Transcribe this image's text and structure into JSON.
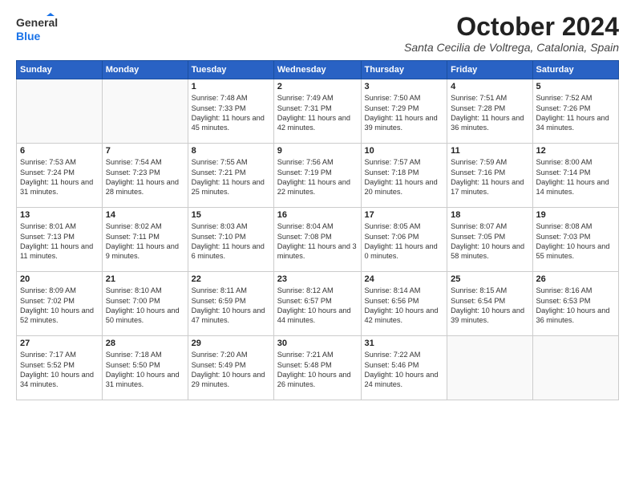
{
  "logo": {
    "line1": "General",
    "line2": "Blue"
  },
  "header": {
    "month": "October 2024",
    "location": "Santa Cecilia de Voltrega, Catalonia, Spain"
  },
  "weekdays": [
    "Sunday",
    "Monday",
    "Tuesday",
    "Wednesday",
    "Thursday",
    "Friday",
    "Saturday"
  ],
  "weeks": [
    [
      {
        "day": "",
        "info": ""
      },
      {
        "day": "",
        "info": ""
      },
      {
        "day": "1",
        "info": "Sunrise: 7:48 AM\nSunset: 7:33 PM\nDaylight: 11 hours and 45 minutes."
      },
      {
        "day": "2",
        "info": "Sunrise: 7:49 AM\nSunset: 7:31 PM\nDaylight: 11 hours and 42 minutes."
      },
      {
        "day": "3",
        "info": "Sunrise: 7:50 AM\nSunset: 7:29 PM\nDaylight: 11 hours and 39 minutes."
      },
      {
        "day": "4",
        "info": "Sunrise: 7:51 AM\nSunset: 7:28 PM\nDaylight: 11 hours and 36 minutes."
      },
      {
        "day": "5",
        "info": "Sunrise: 7:52 AM\nSunset: 7:26 PM\nDaylight: 11 hours and 34 minutes."
      }
    ],
    [
      {
        "day": "6",
        "info": "Sunrise: 7:53 AM\nSunset: 7:24 PM\nDaylight: 11 hours and 31 minutes."
      },
      {
        "day": "7",
        "info": "Sunrise: 7:54 AM\nSunset: 7:23 PM\nDaylight: 11 hours and 28 minutes."
      },
      {
        "day": "8",
        "info": "Sunrise: 7:55 AM\nSunset: 7:21 PM\nDaylight: 11 hours and 25 minutes."
      },
      {
        "day": "9",
        "info": "Sunrise: 7:56 AM\nSunset: 7:19 PM\nDaylight: 11 hours and 22 minutes."
      },
      {
        "day": "10",
        "info": "Sunrise: 7:57 AM\nSunset: 7:18 PM\nDaylight: 11 hours and 20 minutes."
      },
      {
        "day": "11",
        "info": "Sunrise: 7:59 AM\nSunset: 7:16 PM\nDaylight: 11 hours and 17 minutes."
      },
      {
        "day": "12",
        "info": "Sunrise: 8:00 AM\nSunset: 7:14 PM\nDaylight: 11 hours and 14 minutes."
      }
    ],
    [
      {
        "day": "13",
        "info": "Sunrise: 8:01 AM\nSunset: 7:13 PM\nDaylight: 11 hours and 11 minutes."
      },
      {
        "day": "14",
        "info": "Sunrise: 8:02 AM\nSunset: 7:11 PM\nDaylight: 11 hours and 9 minutes."
      },
      {
        "day": "15",
        "info": "Sunrise: 8:03 AM\nSunset: 7:10 PM\nDaylight: 11 hours and 6 minutes."
      },
      {
        "day": "16",
        "info": "Sunrise: 8:04 AM\nSunset: 7:08 PM\nDaylight: 11 hours and 3 minutes."
      },
      {
        "day": "17",
        "info": "Sunrise: 8:05 AM\nSunset: 7:06 PM\nDaylight: 11 hours and 0 minutes."
      },
      {
        "day": "18",
        "info": "Sunrise: 8:07 AM\nSunset: 7:05 PM\nDaylight: 10 hours and 58 minutes."
      },
      {
        "day": "19",
        "info": "Sunrise: 8:08 AM\nSunset: 7:03 PM\nDaylight: 10 hours and 55 minutes."
      }
    ],
    [
      {
        "day": "20",
        "info": "Sunrise: 8:09 AM\nSunset: 7:02 PM\nDaylight: 10 hours and 52 minutes."
      },
      {
        "day": "21",
        "info": "Sunrise: 8:10 AM\nSunset: 7:00 PM\nDaylight: 10 hours and 50 minutes."
      },
      {
        "day": "22",
        "info": "Sunrise: 8:11 AM\nSunset: 6:59 PM\nDaylight: 10 hours and 47 minutes."
      },
      {
        "day": "23",
        "info": "Sunrise: 8:12 AM\nSunset: 6:57 PM\nDaylight: 10 hours and 44 minutes."
      },
      {
        "day": "24",
        "info": "Sunrise: 8:14 AM\nSunset: 6:56 PM\nDaylight: 10 hours and 42 minutes."
      },
      {
        "day": "25",
        "info": "Sunrise: 8:15 AM\nSunset: 6:54 PM\nDaylight: 10 hours and 39 minutes."
      },
      {
        "day": "26",
        "info": "Sunrise: 8:16 AM\nSunset: 6:53 PM\nDaylight: 10 hours and 36 minutes."
      }
    ],
    [
      {
        "day": "27",
        "info": "Sunrise: 7:17 AM\nSunset: 5:52 PM\nDaylight: 10 hours and 34 minutes."
      },
      {
        "day": "28",
        "info": "Sunrise: 7:18 AM\nSunset: 5:50 PM\nDaylight: 10 hours and 31 minutes."
      },
      {
        "day": "29",
        "info": "Sunrise: 7:20 AM\nSunset: 5:49 PM\nDaylight: 10 hours and 29 minutes."
      },
      {
        "day": "30",
        "info": "Sunrise: 7:21 AM\nSunset: 5:48 PM\nDaylight: 10 hours and 26 minutes."
      },
      {
        "day": "31",
        "info": "Sunrise: 7:22 AM\nSunset: 5:46 PM\nDaylight: 10 hours and 24 minutes."
      },
      {
        "day": "",
        "info": ""
      },
      {
        "day": "",
        "info": ""
      }
    ]
  ]
}
